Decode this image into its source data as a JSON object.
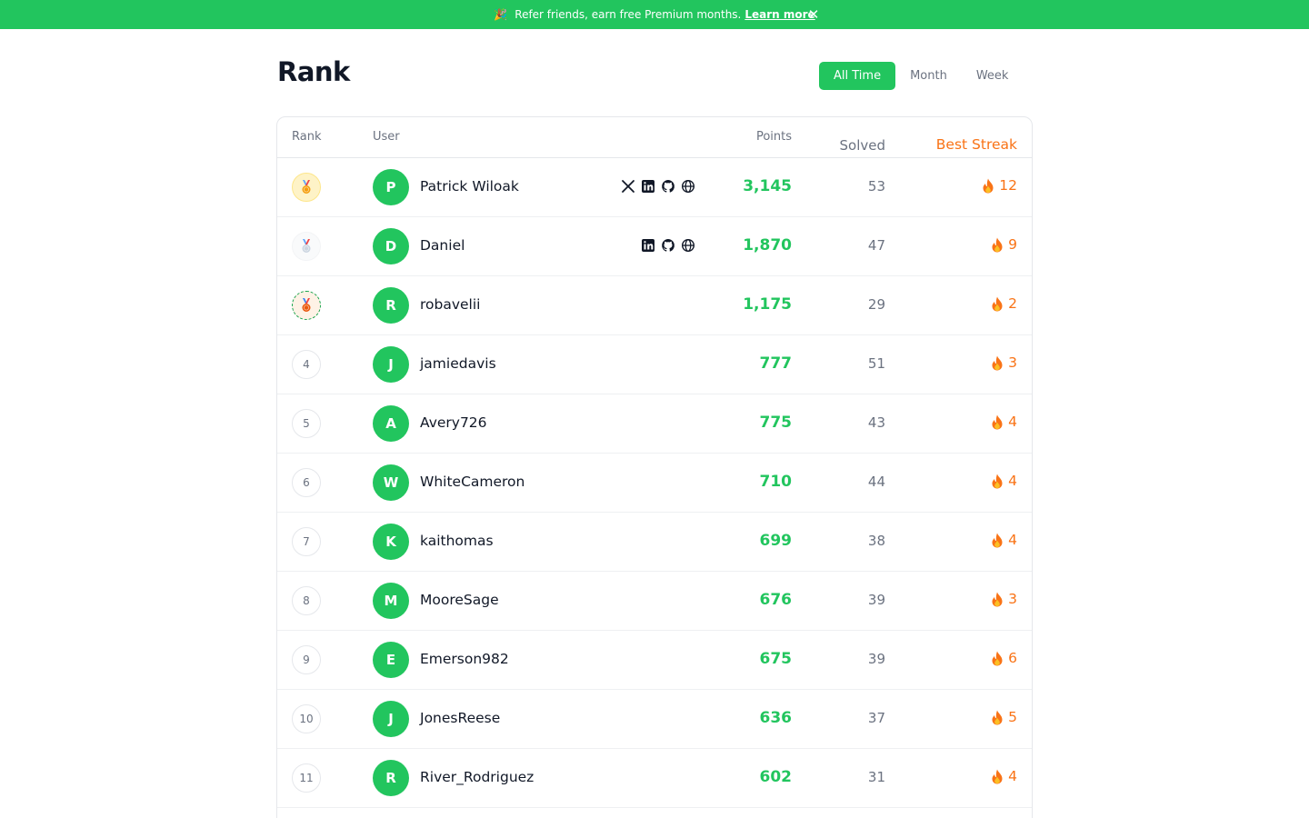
{
  "banner": {
    "emoji": "🎉",
    "text": "Refer friends, earn free Premium months.",
    "link": "Learn more",
    "close": "✕"
  },
  "page": {
    "title": "Rank"
  },
  "periods": [
    "All Time",
    "Month",
    "Week"
  ],
  "active_period": "All Time",
  "columns": {
    "rank": "Rank",
    "user": "User",
    "points": "Points",
    "solved": "Solved",
    "streak": "Best Streak"
  },
  "rows": [
    {
      "rank": "1",
      "medal": "gold",
      "initial": "P",
      "name": "Patrick Wiloak",
      "socials": [
        "x-icon",
        "linkedin-icon",
        "github-icon",
        "globe-icon"
      ],
      "points": "3,145",
      "solved": "53",
      "streak": "12"
    },
    {
      "rank": "2",
      "medal": "silver",
      "initial": "D",
      "name": "Daniel",
      "socials": [
        "linkedin-icon",
        "github-icon",
        "globe-icon"
      ],
      "points": "1,870",
      "solved": "47",
      "streak": "9"
    },
    {
      "rank": "3",
      "medal": "bronze",
      "initial": "R",
      "name": "robavelii",
      "socials": [],
      "points": "1,175",
      "solved": "29",
      "streak": "2"
    },
    {
      "rank": "4",
      "medal": "",
      "initial": "J",
      "name": "jamiedavis",
      "socials": [],
      "points": "777",
      "solved": "51",
      "streak": "3"
    },
    {
      "rank": "5",
      "medal": "",
      "initial": "A",
      "name": "Avery726",
      "socials": [],
      "points": "775",
      "solved": "43",
      "streak": "4"
    },
    {
      "rank": "6",
      "medal": "",
      "initial": "W",
      "name": "WhiteCameron",
      "socials": [],
      "points": "710",
      "solved": "44",
      "streak": "4"
    },
    {
      "rank": "7",
      "medal": "",
      "initial": "K",
      "name": "kaithomas",
      "socials": [],
      "points": "699",
      "solved": "38",
      "streak": "4"
    },
    {
      "rank": "8",
      "medal": "",
      "initial": "M",
      "name": "MooreSage",
      "socials": [],
      "points": "676",
      "solved": "39",
      "streak": "3"
    },
    {
      "rank": "9",
      "medal": "",
      "initial": "E",
      "name": "Emerson982",
      "socials": [],
      "points": "675",
      "solved": "39",
      "streak": "6"
    },
    {
      "rank": "10",
      "medal": "",
      "initial": "J",
      "name": "JonesReese",
      "socials": [],
      "points": "636",
      "solved": "37",
      "streak": "5"
    },
    {
      "rank": "11",
      "medal": "",
      "initial": "R",
      "name": "River_Rodriguez",
      "socials": [],
      "points": "602",
      "solved": "31",
      "streak": "4"
    }
  ],
  "colors": {
    "accent": "#22c55e",
    "streak": "#f97316",
    "muted": "#6b7280",
    "gold": "#fef3c7",
    "silver": "#f9fafb",
    "bronze": "#fef2e6"
  }
}
